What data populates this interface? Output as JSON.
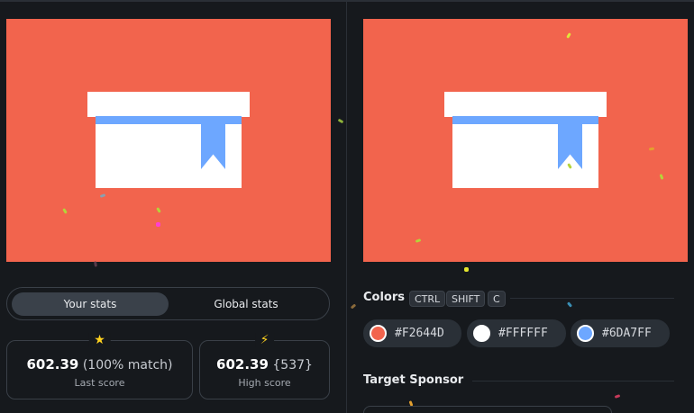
{
  "stats": {
    "tabs": [
      "Your stats",
      "Global stats"
    ],
    "active_tab": "Your stats",
    "last": {
      "score": "602.39",
      "detail": "(100% match)",
      "label": "Last score",
      "icon": "star-icon"
    },
    "high": {
      "score": "602.39",
      "detail": "{537}",
      "label": "High score",
      "icon": "lightning-icon"
    }
  },
  "colors": {
    "title": "Colors",
    "shortcut_keys": [
      "CTRL",
      "SHIFT",
      "C"
    ],
    "swatches": [
      {
        "hex": "#F2644D"
      },
      {
        "hex": "#FFFFFF"
      },
      {
        "hex": "#6DA7FF"
      }
    ]
  },
  "sponsor": {
    "title": "Target Sponsor"
  },
  "palette": {
    "background": "#F2644D",
    "box": "#FFFFFF",
    "ribbon": "#6DA7FF"
  }
}
